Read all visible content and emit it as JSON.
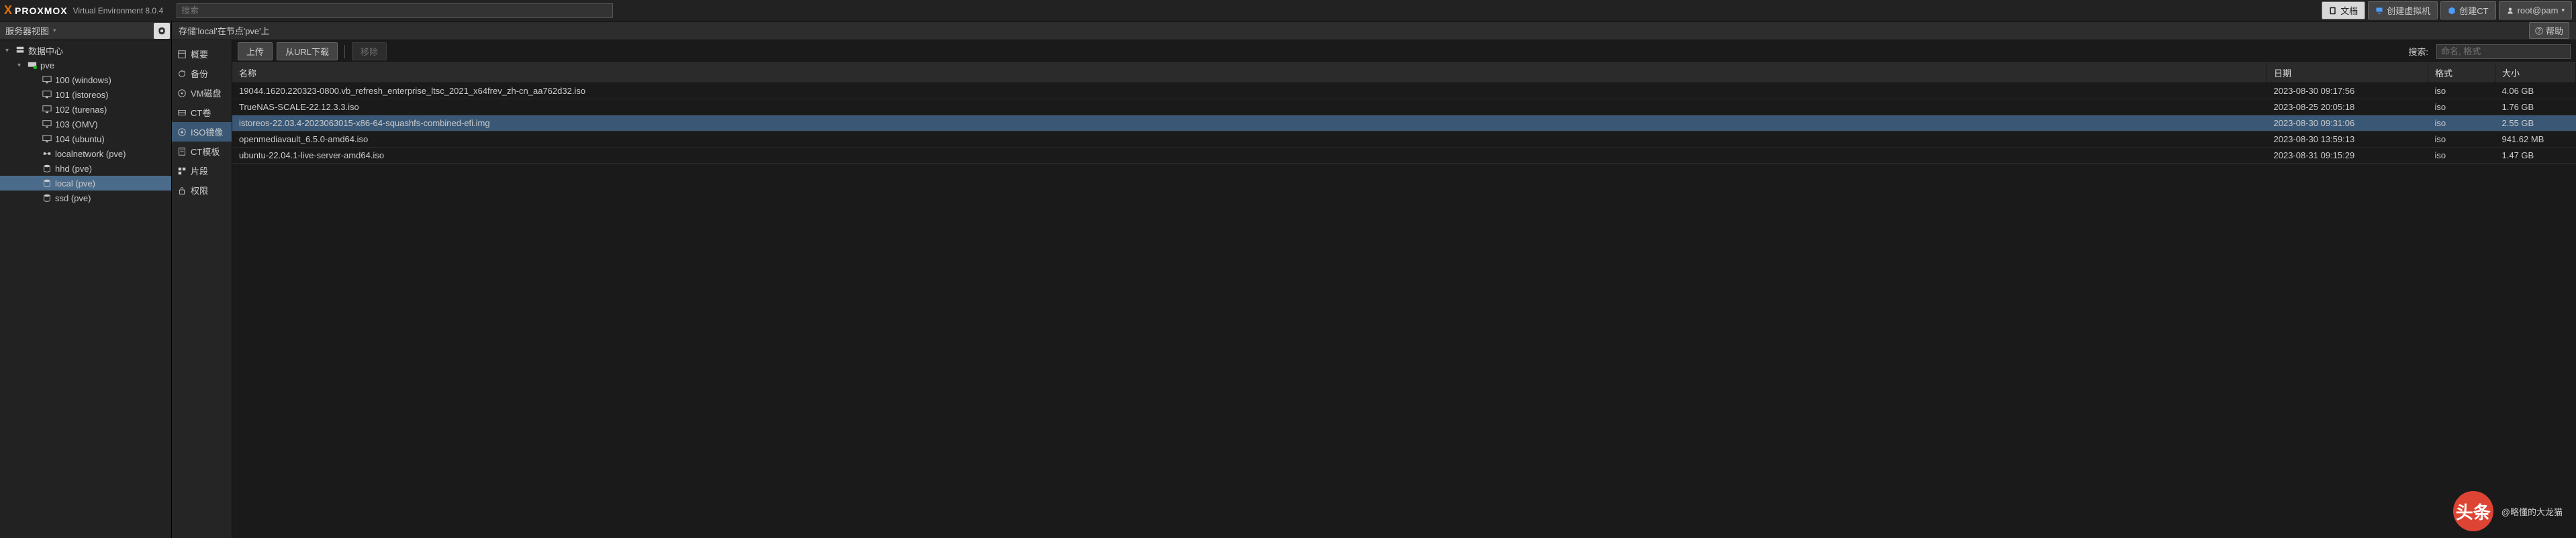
{
  "header": {
    "brand_prefix": "X",
    "brand": "PROXMOX",
    "subtitle": "Virtual Environment 8.0.4",
    "search_placeholder": "搜索",
    "buttons": {
      "docs": "文档",
      "create_vm": "创建虚拟机",
      "create_ct": "创建CT",
      "user": "root@pam"
    }
  },
  "tree": {
    "view_label": "服务器视图",
    "root": "数据中心",
    "node": "pve",
    "vms": [
      {
        "id": "100",
        "name": "100 (windows)"
      },
      {
        "id": "101",
        "name": "101 (istoreos)"
      },
      {
        "id": "102",
        "name": "102 (turenas)"
      },
      {
        "id": "103",
        "name": "103 (OMV)"
      },
      {
        "id": "104",
        "name": "104 (ubuntu)"
      }
    ],
    "storages": [
      {
        "name": "localnetwork (pve)"
      },
      {
        "name": "hhd (pve)"
      },
      {
        "name": "local (pve)",
        "selected": true
      },
      {
        "name": "ssd (pve)"
      }
    ]
  },
  "content": {
    "title": "存储'local'在节点'pve'上",
    "help": "帮助"
  },
  "sub_sidebar": [
    {
      "label": "概要",
      "icon": "summary"
    },
    {
      "label": "备份",
      "icon": "backup"
    },
    {
      "label": "VM磁盘",
      "icon": "disk"
    },
    {
      "label": "CT卷",
      "icon": "ctvol"
    },
    {
      "label": "ISO镜像",
      "icon": "iso",
      "active": true
    },
    {
      "label": "CT模板",
      "icon": "tmpl"
    },
    {
      "label": "片段",
      "icon": "snippet"
    },
    {
      "label": "权限",
      "icon": "perm"
    }
  ],
  "toolbar": {
    "upload": "上传",
    "from_url": "从URL下载",
    "remove": "移除",
    "search_label": "搜索:",
    "search_placeholder": "命名, 格式"
  },
  "table": {
    "columns": {
      "name": "名称",
      "date": "日期",
      "format": "格式",
      "size": "大小"
    },
    "rows": [
      {
        "name": "19044.1620.220323-0800.vb_refresh_enterprise_ltsc_2021_x64frev_zh-cn_aa762d32.iso",
        "date": "2023-08-30 09:17:56",
        "format": "iso",
        "size": "4.06 GB"
      },
      {
        "name": "TrueNAS-SCALE-22.12.3.3.iso",
        "date": "2023-08-25 20:05:18",
        "format": "iso",
        "size": "1.76 GB"
      },
      {
        "name": "istoreos-22.03.4-2023063015-x86-64-squashfs-combined-efi.img",
        "date": "2023-08-30 09:31:06",
        "format": "iso",
        "size": "2.55 GB",
        "selected": true
      },
      {
        "name": "openmediavault_6.5.0-amd64.iso",
        "date": "2023-08-30 13:59:13",
        "format": "iso",
        "size": "941.62 MB"
      },
      {
        "name": "ubuntu-22.04.1-live-server-amd64.iso",
        "date": "2023-08-31 09:15:29",
        "format": "iso",
        "size": "1.47 GB"
      }
    ]
  },
  "watermark": {
    "badge": "头条",
    "text": "@略懂的大龙猫"
  }
}
